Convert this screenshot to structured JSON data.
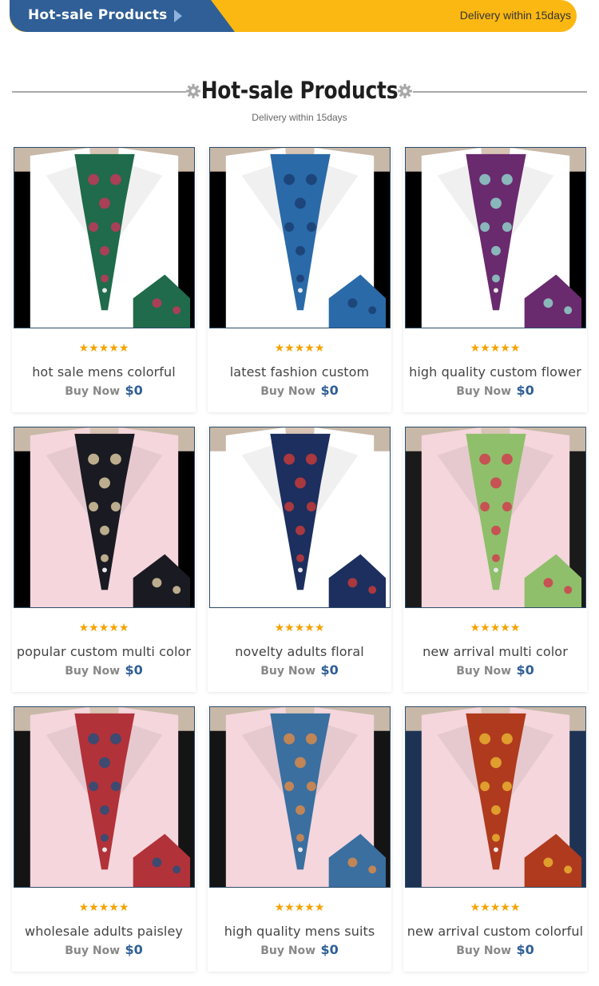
{
  "banner": {
    "title": "Hot-sale Products",
    "delivery": "Delivery within 15days",
    "colors": {
      "left": "#2f5f96",
      "right": "#fcb812"
    }
  },
  "section": {
    "title": "Hot-sale Products",
    "subtitle": "Delivery within 15days",
    "icon": "gear-icon"
  },
  "products": [
    {
      "name": "hot sale mens colorful",
      "buy_label": "Buy Now",
      "price": "$0",
      "stars": "★★★★★",
      "rating": 5,
      "pattern_color": "#1f6b4b",
      "accent": "#c0395a",
      "shirt": "#ffffff",
      "jacket": "#000000"
    },
    {
      "name": "latest fashion custom",
      "buy_label": "Buy Now",
      "price": "$0",
      "stars": "★★★★★",
      "rating": 5,
      "pattern_color": "#2a6aa8",
      "accent": "#1b3f73",
      "shirt": "#ffffff",
      "jacket": "#000000"
    },
    {
      "name": "high quality custom flower",
      "buy_label": "Buy Now",
      "price": "$0",
      "stars": "★★★★★",
      "rating": 5,
      "pattern_color": "#6a2a6e",
      "accent": "#8fd0c8",
      "shirt": "#ffffff",
      "jacket": "#000000"
    },
    {
      "name": "popular custom multi color",
      "buy_label": "Buy Now",
      "price": "$0",
      "stars": "★★★★★",
      "rating": 5,
      "pattern_color": "#1a1a22",
      "accent": "#d8c7a0",
      "shirt": "#f4d6dc",
      "jacket": "#000000"
    },
    {
      "name": "novelty adults floral",
      "buy_label": "Buy Now",
      "price": "$0",
      "stars": "★★★★★",
      "rating": 5,
      "pattern_color": "#1c2f5e",
      "accent": "#c23a3a",
      "shirt": "#ffffff",
      "jacket": "#ffffff"
    },
    {
      "name": "new arrival multi color",
      "buy_label": "Buy Now",
      "price": "$0",
      "stars": "★★★★★",
      "rating": 5,
      "pattern_color": "#8fbf6a",
      "accent": "#d04050",
      "shirt": "#f4d6dc",
      "jacket": "#1a1a1a"
    },
    {
      "name": "wholesale adults paisley",
      "buy_label": "Buy Now",
      "price": "$0",
      "stars": "★★★★★",
      "rating": 5,
      "pattern_color": "#b2323a",
      "accent": "#2a4f7a",
      "shirt": "#f4d6dc",
      "jacket": "#141414"
    },
    {
      "name": "high quality mens suits",
      "buy_label": "Buy Now",
      "price": "$0",
      "stars": "★★★★★",
      "rating": 5,
      "pattern_color": "#3a6fa0",
      "accent": "#d98a4a",
      "shirt": "#f4d6dc",
      "jacket": "#141414"
    },
    {
      "name": "new arrival custom colorful",
      "buy_label": "Buy Now",
      "price": "$0",
      "stars": "★★★★★",
      "rating": 5,
      "pattern_color": "#b03a1e",
      "accent": "#e8b030",
      "shirt": "#f4d6dc",
      "jacket": "#1e3354"
    }
  ]
}
